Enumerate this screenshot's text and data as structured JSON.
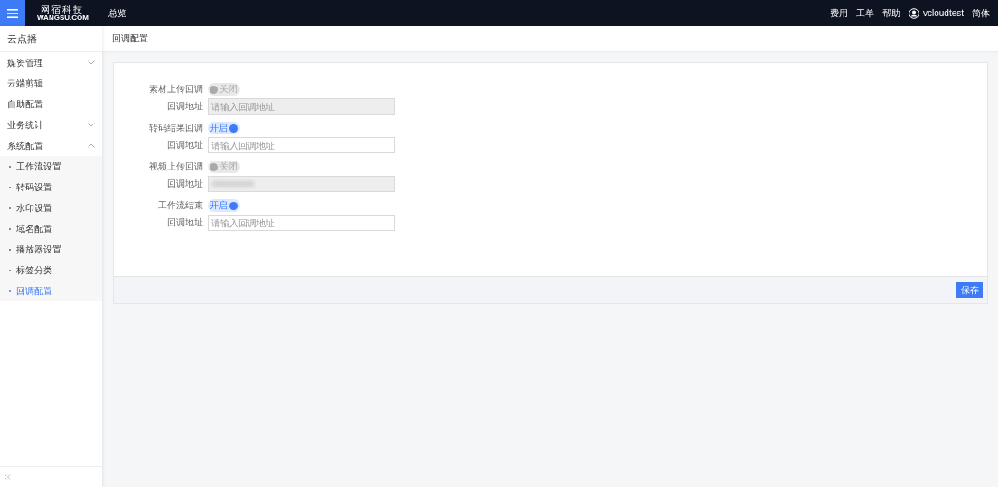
{
  "topbar": {
    "logo_title": "网宿科技",
    "logo_subtitle": "WANGSU.COM",
    "nav": [
      "总览"
    ],
    "links": [
      "费用",
      "工单",
      "帮助"
    ],
    "user": "vcloudtest",
    "language": "简体"
  },
  "sidebar": {
    "title": "云点播",
    "items": [
      {
        "label": "媒资管理",
        "kind": "group",
        "expanded": false
      },
      {
        "label": "云端剪辑",
        "kind": "item",
        "selected": false
      },
      {
        "label": "自助配置",
        "kind": "item",
        "selected": false
      },
      {
        "label": "业务统计",
        "kind": "group",
        "expanded": false
      },
      {
        "label": "系统配置",
        "kind": "group",
        "expanded": true,
        "children": [
          {
            "label": "工作流设置",
            "selected": false
          },
          {
            "label": "转码设置",
            "selected": false
          },
          {
            "label": "水印设置",
            "selected": false
          },
          {
            "label": "域名配置",
            "selected": false
          },
          {
            "label": "播放器设置",
            "selected": false
          },
          {
            "label": "标签分类",
            "selected": false
          },
          {
            "label": "回调配置",
            "selected": true
          }
        ]
      }
    ]
  },
  "page_title": "回调配置",
  "form": [
    {
      "label": "素材上传回调",
      "switch_text": "关闭",
      "on": false,
      "address_label": "回调地址",
      "placeholder": "请输入回调地址",
      "redacted": false
    },
    {
      "label": "转码结果回调",
      "switch_text": "开启",
      "on": true,
      "address_label": "回调地址",
      "placeholder": "请输入回调地址",
      "redacted": false
    },
    {
      "label": "视频上传回调",
      "switch_text": "关闭",
      "on": false,
      "address_label": "回调地址",
      "redacted": true
    },
    {
      "label": "工作流结束",
      "switch_text": "开启",
      "on": true,
      "address_label": "回调地址",
      "placeholder": "请输入回调地址",
      "redacted": false
    }
  ],
  "save_button": "保存"
}
